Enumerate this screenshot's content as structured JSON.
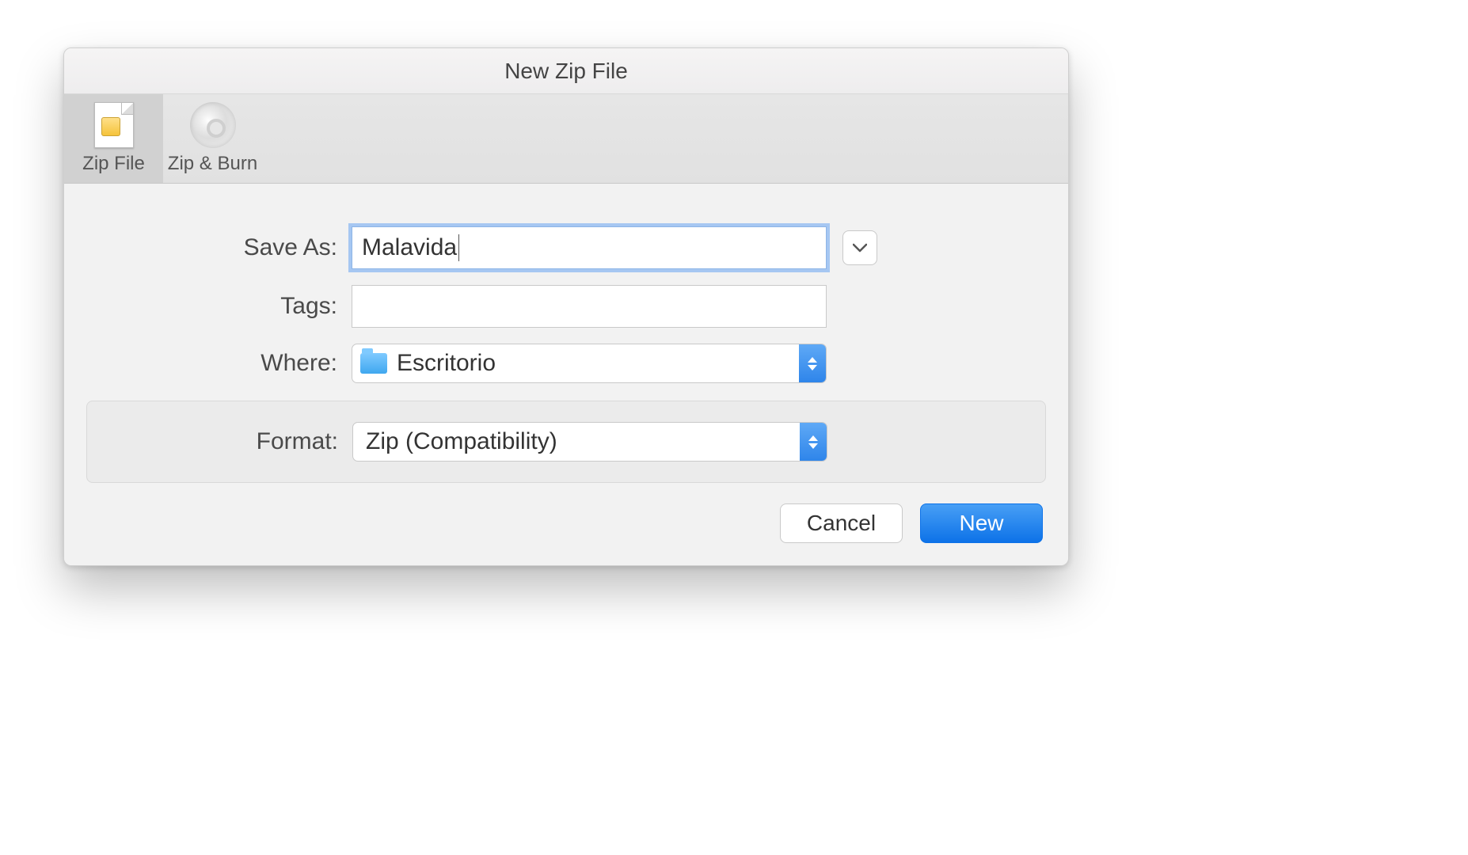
{
  "dialog": {
    "title": "New Zip File"
  },
  "toolbar": {
    "zip_file_label": "Zip File",
    "zip_burn_label": "Zip & Burn"
  },
  "form": {
    "save_as_label": "Save As:",
    "save_as_value": "Malavida",
    "tags_label": "Tags:",
    "tags_value": "",
    "where_label": "Where:",
    "where_value": "Escritorio",
    "format_label": "Format:",
    "format_value": "Zip (Compatibility)"
  },
  "buttons": {
    "cancel": "Cancel",
    "new": "New"
  },
  "icons": {
    "zip_file": "zip-file-icon",
    "disc": "disc-icon",
    "folder": "folder-icon",
    "chevron_down": "chevron-down-icon",
    "stepper": "stepper-icon"
  },
  "colors": {
    "accent_blue": "#2f85ea",
    "focus_ring": "#a6c7f2",
    "panel_bg": "#f2f2f2"
  }
}
